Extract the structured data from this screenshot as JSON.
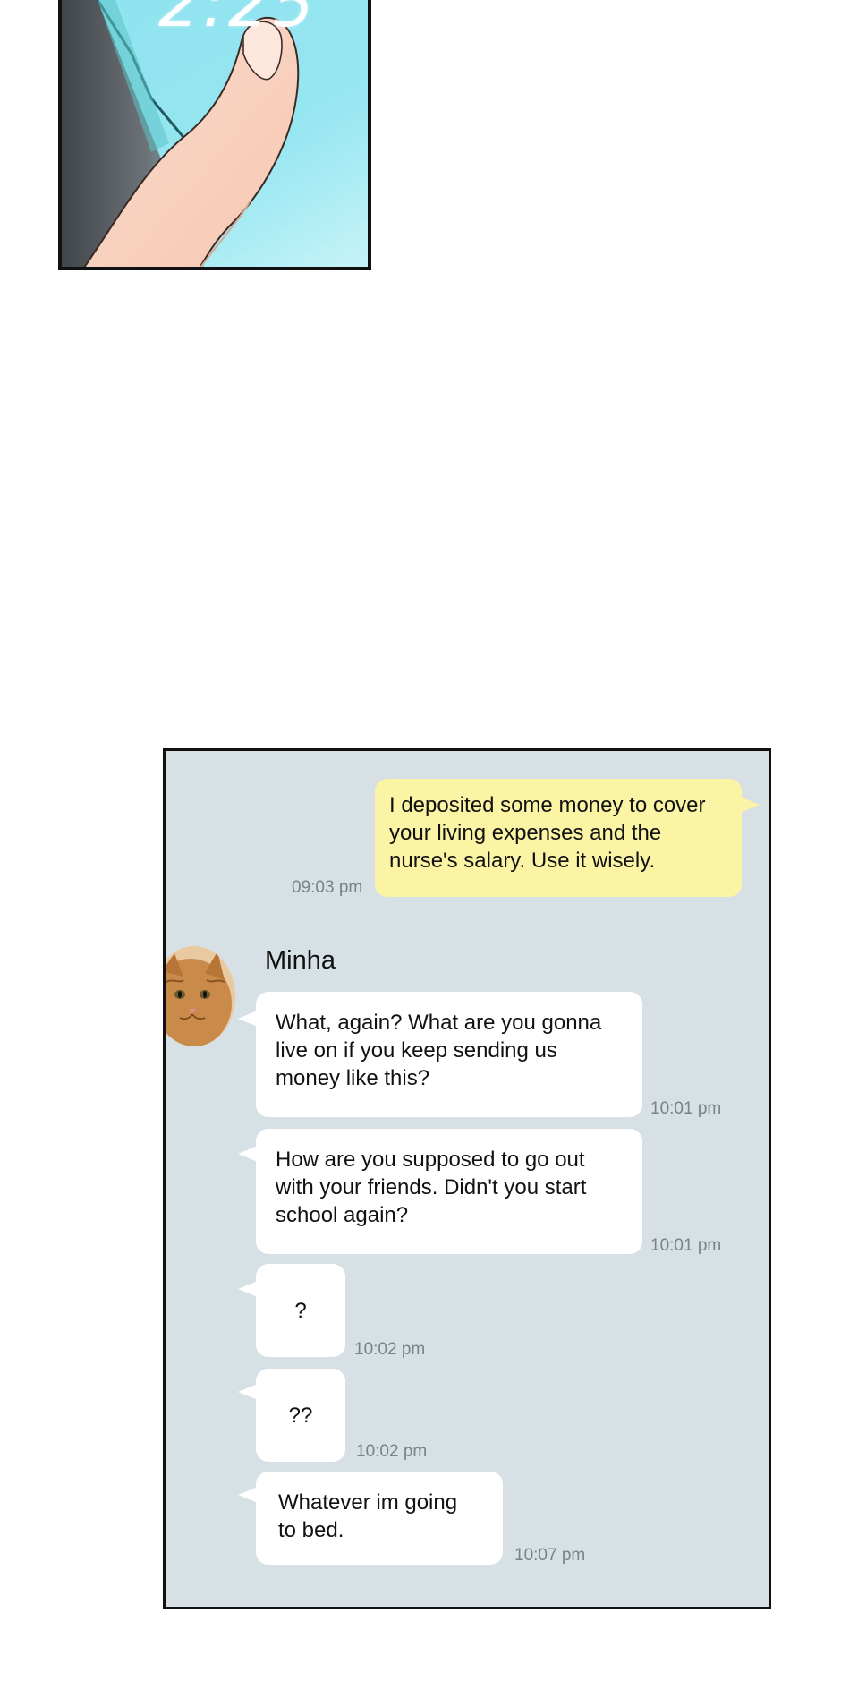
{
  "chat": {
    "outgoing": {
      "text": "I deposited some money to cover your living expenses and the nurse's salary. Use it wisely.",
      "time": "09:03 pm"
    },
    "contact": {
      "name": "Minha"
    },
    "incoming": [
      {
        "text": "What, again? What are you gonna live on if you keep sending us money like this?",
        "time": "10:01 pm"
      },
      {
        "text": "How are you supposed to go out with your friends. Didn't you start school again?",
        "time": "10:01 pm"
      },
      {
        "text": "?",
        "time": "10:02 pm"
      },
      {
        "text": "??",
        "time": "10:02 pm"
      },
      {
        "text": "Whatever im going to bed.",
        "time": "10:07 pm"
      }
    ]
  },
  "colors": {
    "chat_background": "#d6e0e5",
    "sent_bubble": "#fbf4a4",
    "received_bubble": "#ffffff",
    "timestamp": "#7a8288"
  },
  "icons": {
    "avatar": "orange-cat-avatar"
  }
}
